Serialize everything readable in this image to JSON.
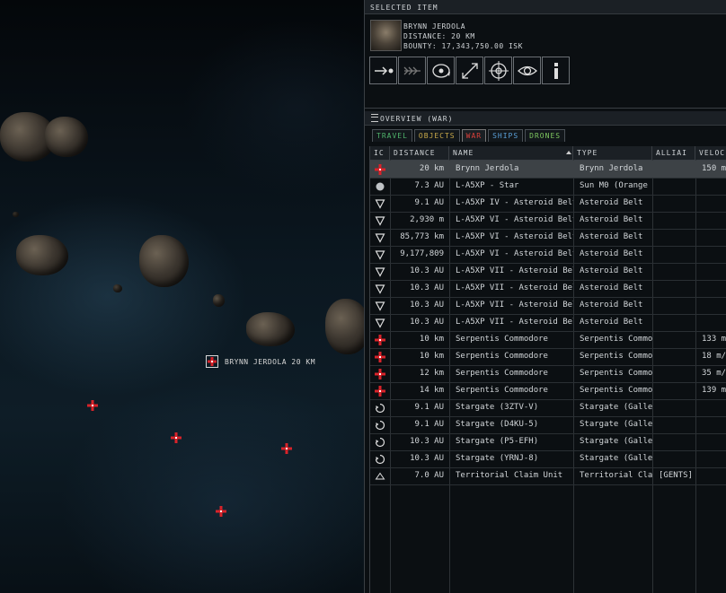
{
  "space": {
    "target_label": "BRYNN JERDOLA 20 KM",
    "markers": [
      "hostile-marker",
      "hostile-marker",
      "hostile-marker",
      "hostile-marker"
    ]
  },
  "selected_item": {
    "title": "SELECTED ITEM",
    "name": "BRYNN JERDOLA",
    "distance": "DISTANCE: 20 KM",
    "bounty": "BOUNTY: 17,343,750.00 ISK",
    "actions": [
      "approach-icon",
      "warp-icon",
      "orbit-icon",
      "keep-range-icon",
      "lock-target-icon",
      "look-at-icon",
      "info-icon"
    ]
  },
  "overview": {
    "title": "OVERVIEW (WAR)",
    "tabs": [
      {
        "label": "TRAVEL",
        "color": "#4fb36b",
        "active": false
      },
      {
        "label": "OBJECTS",
        "color": "#c9a94a",
        "active": false
      },
      {
        "label": "WAR",
        "color": "#d8403a",
        "active": true
      },
      {
        "label": "SHIPS",
        "color": "#5aa0d8",
        "active": false
      },
      {
        "label": "DRONES",
        "color": "#7fc860",
        "active": false
      }
    ],
    "columns": [
      "IC",
      "DISTANCE",
      "NAME",
      "TYPE",
      "ALLIAI",
      "VELOC"
    ],
    "rows": [
      {
        "icon": "hostile-icon",
        "distance": "20 km",
        "name": "Brynn Jerdola",
        "type": "Brynn Jerdola",
        "alliance": "",
        "velocity": "150 m",
        "selected": true
      },
      {
        "icon": "sun-icon",
        "distance": "7.3 AU",
        "name": "L-A5XP - Star",
        "type": "Sun M0 (Orange",
        "alliance": "",
        "velocity": ""
      },
      {
        "icon": "asteroid-belt-icon",
        "distance": "9.1 AU",
        "name": "L-A5XP IV - Asteroid Belt",
        "type": "Asteroid Belt",
        "alliance": "",
        "velocity": ""
      },
      {
        "icon": "asteroid-belt-icon",
        "distance": "2,930 m",
        "name": "L-A5XP VI - Asteroid Belt",
        "type": "Asteroid Belt",
        "alliance": "",
        "velocity": ""
      },
      {
        "icon": "asteroid-belt-icon",
        "distance": "85,773 km",
        "name": "L-A5XP VI - Asteroid Belt",
        "type": "Asteroid Belt",
        "alliance": "",
        "velocity": ""
      },
      {
        "icon": "asteroid-belt-icon",
        "distance": "9,177,809",
        "name": "L-A5XP VI - Asteroid Belt",
        "type": "Asteroid Belt",
        "alliance": "",
        "velocity": ""
      },
      {
        "icon": "asteroid-belt-icon",
        "distance": "10.3 AU",
        "name": "L-A5XP VII - Asteroid Belt",
        "type": "Asteroid Belt",
        "alliance": "",
        "velocity": ""
      },
      {
        "icon": "asteroid-belt-icon",
        "distance": "10.3 AU",
        "name": "L-A5XP VII - Asteroid Belt",
        "type": "Asteroid Belt",
        "alliance": "",
        "velocity": ""
      },
      {
        "icon": "asteroid-belt-icon",
        "distance": "10.3 AU",
        "name": "L-A5XP VII - Asteroid Belt",
        "type": "Asteroid Belt",
        "alliance": "",
        "velocity": ""
      },
      {
        "icon": "asteroid-belt-icon",
        "distance": "10.3 AU",
        "name": "L-A5XP VII - Asteroid Belt",
        "type": "Asteroid Belt",
        "alliance": "",
        "velocity": ""
      },
      {
        "icon": "hostile-icon",
        "distance": "10 km",
        "name": "Serpentis Commodore",
        "type": "Serpentis Commo",
        "alliance": "",
        "velocity": "133 m"
      },
      {
        "icon": "hostile-icon",
        "distance": "10 km",
        "name": "Serpentis Commodore",
        "type": "Serpentis Commo",
        "alliance": "",
        "velocity": "18 m/"
      },
      {
        "icon": "hostile-icon",
        "distance": "12 km",
        "name": "Serpentis Commodore",
        "type": "Serpentis Commo",
        "alliance": "",
        "velocity": "35 m/"
      },
      {
        "icon": "hostile-icon",
        "distance": "14 km",
        "name": "Serpentis Commodore",
        "type": "Serpentis Commo",
        "alliance": "",
        "velocity": "139 m"
      },
      {
        "icon": "stargate-icon",
        "distance": "9.1 AU",
        "name": "Stargate (3ZTV-V)",
        "type": "Stargate (Gallent",
        "alliance": "",
        "velocity": ""
      },
      {
        "icon": "stargate-icon",
        "distance": "9.1 AU",
        "name": "Stargate (D4KU-5)",
        "type": "Stargate (Gallent",
        "alliance": "",
        "velocity": ""
      },
      {
        "icon": "stargate-icon",
        "distance": "10.3 AU",
        "name": "Stargate (P5-EFH)",
        "type": "Stargate (Gallent",
        "alliance": "",
        "velocity": ""
      },
      {
        "icon": "stargate-icon",
        "distance": "10.3 AU",
        "name": "Stargate (YRNJ-8)",
        "type": "Stargate (Gallent",
        "alliance": "",
        "velocity": ""
      },
      {
        "icon": "claim-unit-icon",
        "distance": "7.0 AU",
        "name": "Territorial Claim Unit",
        "type": "Territorial Claim",
        "alliance": "[GENTS]",
        "velocity": ""
      }
    ]
  }
}
